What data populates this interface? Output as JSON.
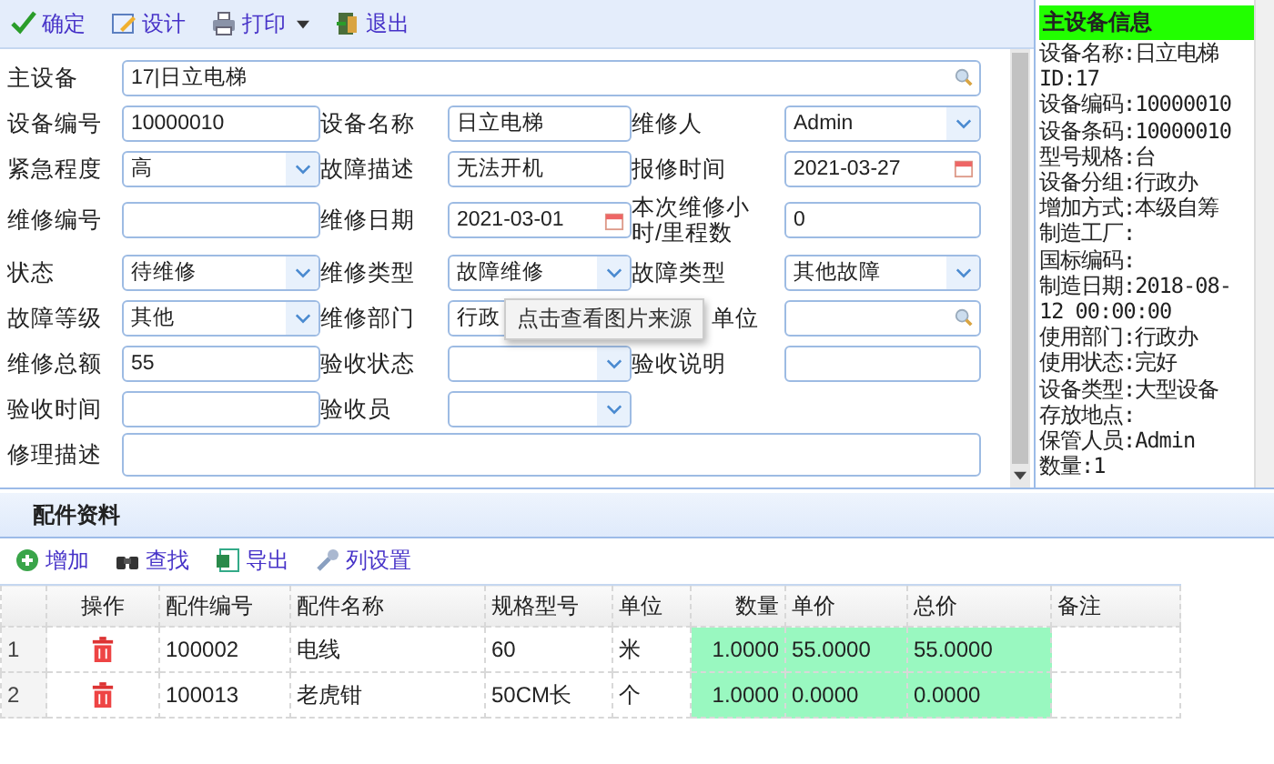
{
  "toolbar": [
    {
      "label": "确定",
      "kind": "confirm",
      "has_menu": false
    },
    {
      "label": "设计",
      "kind": "design",
      "has_menu": false
    },
    {
      "label": "打印",
      "kind": "print",
      "has_menu": true
    },
    {
      "label": "退出",
      "kind": "exit",
      "has_menu": false
    }
  ],
  "form": {
    "rows": [
      [
        {
          "label": "主设备",
          "kind": "search",
          "value": "17|日立电梯",
          "wide": true
        }
      ],
      [
        {
          "label": "设备编号",
          "kind": "text",
          "value": "10000010"
        },
        {
          "label": "设备名称",
          "kind": "text",
          "value": "日立电梯"
        },
        {
          "label": "维修人",
          "kind": "select",
          "value": "Admin"
        }
      ],
      [
        {
          "label": "紧急程度",
          "kind": "select",
          "value": "高"
        },
        {
          "label": "故障描述",
          "kind": "text",
          "value": "无法开机"
        },
        {
          "label": "报修时间",
          "kind": "date",
          "value": "2021-03-27"
        }
      ],
      [
        {
          "label": "维修编号",
          "kind": "text"
        },
        {
          "label": "维修日期",
          "kind": "date",
          "value": "2021-03-01"
        },
        {
          "label": "本次维修小时/里程数",
          "kind": "text",
          "value": "0"
        }
      ],
      [
        {
          "label": "状态",
          "kind": "select",
          "value": "待维修"
        },
        {
          "label": "维修类型",
          "kind": "select",
          "value": "故障维修"
        },
        {
          "label": "故障类型",
          "kind": "select",
          "value": "其他故障"
        }
      ],
      [
        {
          "label": "故障等级",
          "kind": "select",
          "value": "其他"
        },
        {
          "label": "维修部门",
          "kind": "text",
          "value": "行政"
        },
        {
          "label": "单位",
          "kind": "search",
          "covered": true
        }
      ],
      [
        {
          "label": "维修总额",
          "kind": "text",
          "value": "55"
        },
        {
          "label": "验收状态",
          "kind": "select"
        },
        {
          "label": "验收说明",
          "kind": "text"
        }
      ],
      [
        {
          "label": "验收时间",
          "kind": "text"
        },
        {
          "label": "验收员",
          "kind": "select"
        }
      ],
      [
        {
          "label": "修理描述",
          "kind": "text",
          "wide": true
        }
      ]
    ]
  },
  "tooltip": "点击查看图片来源",
  "info_panel": {
    "title": "主设备信息",
    "lines": [
      "设备名称:日立电梯",
      "ID:17",
      "设备编码:10000010",
      "设备条码:10000010",
      "型号规格:台",
      "设备分组:行政办",
      "增加方式:本级自筹",
      "制造工厂:",
      "国标编码:",
      "制造日期:2018-08-12 00:00:00",
      "使用部门:行政办",
      "使用状态:完好",
      "设备类型:大型设备",
      "存放地点:",
      "保管人员:Admin",
      "数量:1"
    ]
  },
  "parts": {
    "title": "配件资料",
    "toolbar": [
      {
        "label": "增加",
        "kind": "add"
      },
      {
        "label": "查找",
        "kind": "find"
      },
      {
        "label": "导出",
        "kind": "export"
      },
      {
        "label": "列设置",
        "kind": "settings"
      }
    ],
    "action_column": "操作",
    "columns": [
      {
        "label": "配件编号",
        "highlighted": false
      },
      {
        "label": "配件名称",
        "highlighted": false
      },
      {
        "label": "规格型号",
        "highlighted": false
      },
      {
        "label": "单位",
        "highlighted": false
      },
      {
        "label": "数量",
        "highlighted": true
      },
      {
        "label": "单价",
        "highlighted": true
      },
      {
        "label": "总价",
        "highlighted": true
      },
      {
        "label": "备注",
        "highlighted": false
      }
    ],
    "rows": [
      {
        "number": "1",
        "cells": [
          "100002",
          "电线",
          "60",
          "米",
          "1.0000",
          "55.0000",
          "55.0000"
        ]
      },
      {
        "number": "2",
        "cells": [
          "100013",
          "老虎钳",
          "50CM长",
          "个",
          "1.0000",
          "0.0000",
          "0.0000"
        ]
      }
    ]
  }
}
